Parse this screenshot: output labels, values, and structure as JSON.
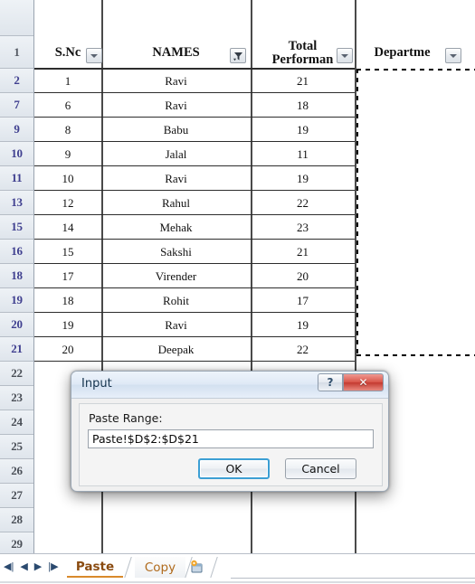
{
  "grid": {
    "row_header_width": 38,
    "columns": [
      {
        "key": "sno",
        "header": "S.No",
        "header_display": "S.Nc",
        "filtered": false
      },
      {
        "key": "name",
        "header": "NAMES",
        "header_display": "NAMES",
        "filtered": true
      },
      {
        "key": "perf",
        "header": "Total Performance",
        "header_display_line1": "Total",
        "header_display_line2": "Performan",
        "filtered": false
      },
      {
        "key": "dept",
        "header": "Department",
        "header_display": "Departme",
        "filtered": false
      }
    ],
    "header_row_number": "1",
    "rows": [
      {
        "row": "2",
        "sno": "1",
        "name": "Ravi",
        "perf": "21",
        "dept": ""
      },
      {
        "row": "7",
        "sno": "6",
        "name": "Ravi",
        "perf": "18",
        "dept": ""
      },
      {
        "row": "9",
        "sno": "8",
        "name": "Babu",
        "perf": "19",
        "dept": ""
      },
      {
        "row": "10",
        "sno": "9",
        "name": "Jalal",
        "perf": "11",
        "dept": ""
      },
      {
        "row": "11",
        "sno": "10",
        "name": "Ravi",
        "perf": "19",
        "dept": ""
      },
      {
        "row": "13",
        "sno": "12",
        "name": "Rahul",
        "perf": "22",
        "dept": ""
      },
      {
        "row": "15",
        "sno": "14",
        "name": "Mehak",
        "perf": "23",
        "dept": ""
      },
      {
        "row": "16",
        "sno": "15",
        "name": "Sakshi",
        "perf": "21",
        "dept": ""
      },
      {
        "row": "18",
        "sno": "17",
        "name": "Virender",
        "perf": "20",
        "dept": ""
      },
      {
        "row": "19",
        "sno": "18",
        "name": "Rohit",
        "perf": "17",
        "dept": ""
      },
      {
        "row": "20",
        "sno": "19",
        "name": "Ravi",
        "perf": "19",
        "dept": ""
      },
      {
        "row": "21",
        "sno": "20",
        "name": "Deepak",
        "perf": "22",
        "dept": ""
      }
    ],
    "empty_rows": [
      "22",
      "23",
      "24",
      "25",
      "26",
      "27",
      "28",
      "29"
    ],
    "selection_note": "marching-ants copy selection on Department column",
    "colors": {
      "filtered_row_header_text": "#3f3f8f",
      "grid_line": "#2d2d2d",
      "row_header_bg": "#e3e8ee"
    }
  },
  "dialog": {
    "title": "Input",
    "help_button": "?",
    "close_button": "✕",
    "field_label": "Paste Range:",
    "field_value": "Paste!$D$2:$D$21",
    "field_placeholder": "",
    "ok_label": "OK",
    "cancel_label": "Cancel"
  },
  "tabbar": {
    "nav_first": "◀|",
    "nav_prev": "◀",
    "nav_next": "▶",
    "nav_last": "|▶",
    "tabs": [
      {
        "label": "Paste",
        "active": true
      },
      {
        "label": "Copy",
        "active": false
      }
    ],
    "insert_sheet_icon": "insert-worksheet-icon"
  }
}
